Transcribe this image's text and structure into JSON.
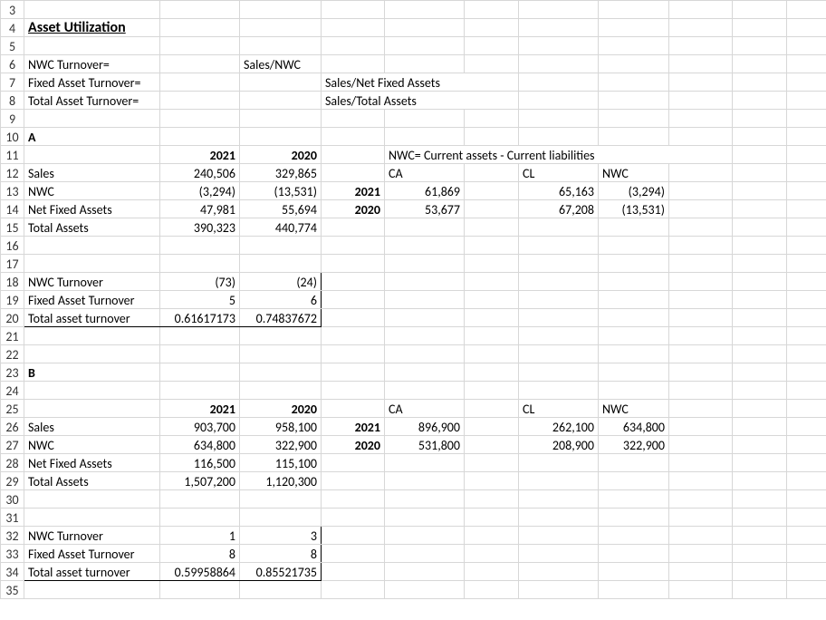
{
  "rows": [
    "3",
    "4",
    "5",
    "6",
    "7",
    "8",
    "9",
    "10",
    "11",
    "12",
    "13",
    "14",
    "15",
    "16",
    "17",
    "18",
    "19",
    "20",
    "21",
    "22",
    "23",
    "24",
    "25",
    "26",
    "27",
    "28",
    "29",
    "30",
    "31",
    "32",
    "33",
    "34",
    "35"
  ],
  "title": "Asset Utilization",
  "formulas": {
    "nwc_turnover_label": "NWC Turnover=",
    "nwc_turnover_formula": "Sales/NWC",
    "fixed_asset_turnover_label": "Fixed Asset Turnover=",
    "fixed_asset_turnover_formula": "Sales/Net Fixed Assets",
    "total_asset_turnover_label": "Total Asset Turnover=",
    "total_asset_turnover_formula": "Sales/Total Assets"
  },
  "section_a": {
    "label": "A",
    "headers": {
      "y2021": "2021",
      "y2020": "2020"
    },
    "rows": {
      "sales": {
        "label": "Sales",
        "y2021": "240,506",
        "y2020": "329,865"
      },
      "nwc": {
        "label": "NWC",
        "y2021": "(3,294)",
        "y2020": "(13,531)"
      },
      "net_fixed_assets": {
        "label": "Net Fixed Assets",
        "y2021": "47,981",
        "y2020": "55,694"
      },
      "total_assets": {
        "label": "Total Assets",
        "y2021": "390,323",
        "y2020": "440,774"
      }
    },
    "ratios": {
      "nwc_turnover": {
        "label": "NWC Turnover",
        "y2021": "(73)",
        "y2020": "(24)"
      },
      "fixed_asset_turnover": {
        "label": "Fixed Asset Turnover",
        "y2021": "5",
        "y2020": "6"
      },
      "total_asset_turnover": {
        "label": "Total asset turnover",
        "y2021": "0.61617173",
        "y2020": "0.74837672"
      }
    },
    "nwc_calc": {
      "title": "NWC= Current assets - Current liabilities",
      "headers": {
        "ca": "CA",
        "cl": "CL",
        "nwc": "NWC"
      },
      "y2021": {
        "label": "2021",
        "ca": "61,869",
        "cl": "65,163",
        "nwc": "(3,294)"
      },
      "y2020": {
        "label": "2020",
        "ca": "53,677",
        "cl": "67,208",
        "nwc": "(13,531)"
      }
    }
  },
  "section_b": {
    "label": "B",
    "headers": {
      "y2021": "2021",
      "y2020": "2020"
    },
    "rows": {
      "sales": {
        "label": "Sales",
        "y2021": "903,700",
        "y2020": "958,100"
      },
      "nwc": {
        "label": "NWC",
        "y2021": "634,800",
        "y2020": "322,900"
      },
      "net_fixed_assets": {
        "label": "Net Fixed Assets",
        "y2021": "116,500",
        "y2020": "115,100"
      },
      "total_assets": {
        "label": "Total Assets",
        "y2021": "1,507,200",
        "y2020": "1,120,300"
      }
    },
    "ratios": {
      "nwc_turnover": {
        "label": "NWC Turnover",
        "y2021": "1",
        "y2020": "3"
      },
      "fixed_asset_turnover": {
        "label": "Fixed Asset Turnover",
        "y2021": "8",
        "y2020": "8"
      },
      "total_asset_turnover": {
        "label": "Total asset turnover",
        "y2021": "0.59958864",
        "y2020": "0.85521735"
      }
    },
    "nwc_calc": {
      "headers": {
        "ca": "CA",
        "cl": "CL",
        "nwc": "NWC"
      },
      "y2021": {
        "label": "2021",
        "ca": "896,900",
        "cl": "262,100",
        "nwc": "634,800"
      },
      "y2020": {
        "label": "2020",
        "ca": "531,800",
        "cl": "208,900",
        "nwc": "322,900"
      }
    }
  }
}
